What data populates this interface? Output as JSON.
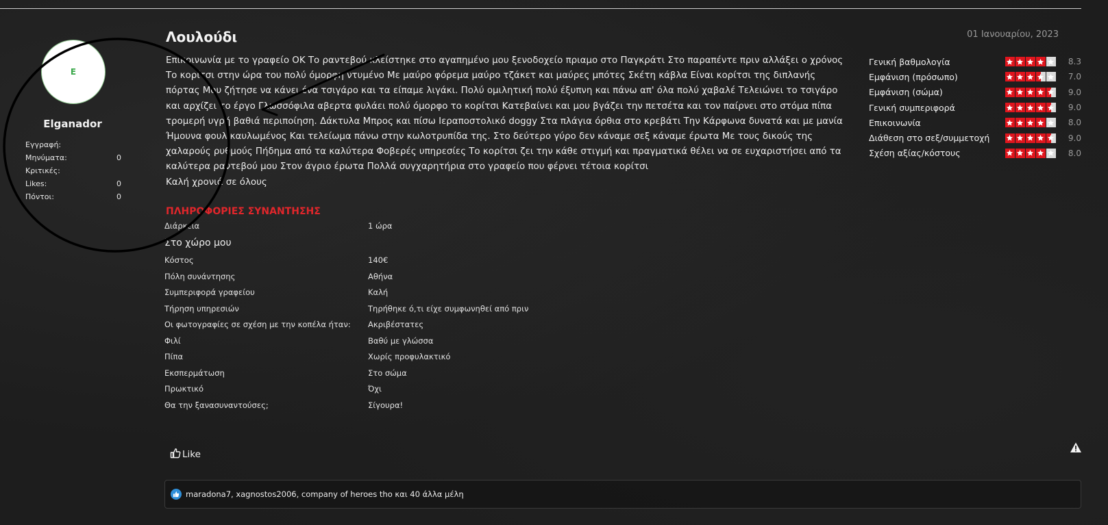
{
  "user": {
    "avatar_letter": "E",
    "username": "Elganador",
    "stats": [
      {
        "label": "Εγγραφή:",
        "value": ""
      },
      {
        "label": "Μηνύματα:",
        "value": "0"
      },
      {
        "label": "Κριτικές:",
        "value": ""
      },
      {
        "label": "Likes:",
        "value": "0"
      },
      {
        "label": "Πόντοι:",
        "value": "0"
      }
    ]
  },
  "review": {
    "title": "Λουλούδι",
    "date": "01 Ιανουαρίου, 2023",
    "body": "Επικοινωνία με το γραφείο ΟΚ Το ραντεβού κλείστηκε στο αγαπημένο μου ξενοδοχείο πριαμο στο Παγκράτι Στο παραπέντε πριν αλλάξει ο χρόνος Το κορίτσι στην ώρα του πολύ όμορφη ντυμένο Με μαύρο φόρεμα μαύρο τζάκετ και μαύρες μπότες Σκέτη κάβλα Είναι κορίτσι της διπλανής πόρτας Μου ζήτησε να κάνει ένα τσιγάρο και τα είπαμε λιγάκι. Πολύ ομιλητική πολύ έξυπνη και πάνω απ' όλα πολύ χαβαλέ Τελειώνει το τσιγάρο και αρχίζει το έργο Γλωσσόφιλα αβερτα φυλάει πολύ όμορφο το κορίτσι Κατεβαίνει και μου βγάζει την πετσέτα και τον παίρνει στο στόμα πίπα τρομερή υγρή βαθιά περιποίηση. Δάκτυλα Μπρος και πίσω Ιεραποστολικό doggy Στα πλάγια όρθια στο κρεβάτι Την Κάρφωνα δυνατά και με μανία Ήμουνα φουλ καυλωμένος Και τελείωμα πάνω στην κωλοτρυπίδα της. Στο δεύτερο γύρο δεν κάναμε σεξ κάναμε έρωτα Με τους δικούς της χαλαρούς ρυθμούς Πήδημα από τα καλύτερα Φοβερές υπηρεσίες Το κορίτσι ζει την κάθε στιγμή και πραγματικά θέλει να σε ευχαριστήσει από τα καλύτερα ραντεβού μου Στον άγριο έρωτα Πολλά συγχαρητήρια στο γραφείο που φέρνει τέτοια κορίτσι",
    "closing": "Καλή χρονιά σε όλους"
  },
  "meeting": {
    "section_title": "ΠΛΗΡΟΦΟΡΙΕΣ ΣΥΝΑΝΤΗΣΗΣ",
    "duration_label": "Διάρκεια",
    "duration_value": "1 ώρα",
    "location_heading": "Στο χώρο μου",
    "rows": [
      {
        "label": "Κόστος",
        "value": "140€"
      },
      {
        "label": "Πόλη συνάντησης",
        "value": "Αθήνα"
      },
      {
        "label": "Συμπεριφορά γραφείου",
        "value": "Καλή"
      },
      {
        "label": "Τήρηση υπηρεσιών",
        "value": "Τηρήθηκε ό,τι είχε συμφωνηθεί από πριν"
      },
      {
        "label": "Οι φωτογραφίες σε σχέση με την κοπέλα ήταν:",
        "value": "Ακριβέστατες"
      },
      {
        "label": "Φιλί",
        "value": "Βαθύ με γλώσσα"
      },
      {
        "label": "Πίπα",
        "value": "Χωρίς προφυλακτικό"
      },
      {
        "label": "Εκσπερμάτωση",
        "value": "Στο σώμα"
      },
      {
        "label": "Πρωκτικό",
        "value": "Όχι"
      },
      {
        "label": "Θα την ξανασυναντούσες;",
        "value": "Σίγουρα!"
      }
    ]
  },
  "ratings": {
    "star_color": "#e0151d",
    "items": [
      {
        "label": "Γενική βαθμολογία",
        "score": "8.3",
        "rating": 4
      },
      {
        "label": "Εμφάνιση (πρόσωπο)",
        "score": "7.0",
        "rating": 3.5
      },
      {
        "label": "Εμφάνιση (σώμα)",
        "score": "9.0",
        "rating": 4.5
      },
      {
        "label": "Γενική συμπεριφορά",
        "score": "9.0",
        "rating": 4.5
      },
      {
        "label": "Επικοινωνία",
        "score": "8.0",
        "rating": 4
      },
      {
        "label": "Διάθεση στο σεξ/συμμετοχή",
        "score": "9.0",
        "rating": 4.5
      },
      {
        "label": "Σχέση αξίας/κόστους",
        "score": "8.0",
        "rating": 4
      }
    ]
  },
  "actions": {
    "like_label": "Like",
    "like_icon": "thumbs-up-icon",
    "report_icon": "warning-icon",
    "likes_summary": "maradona7, xagnostos2006, company of heroes tho και 40 άλλα μέλη"
  }
}
